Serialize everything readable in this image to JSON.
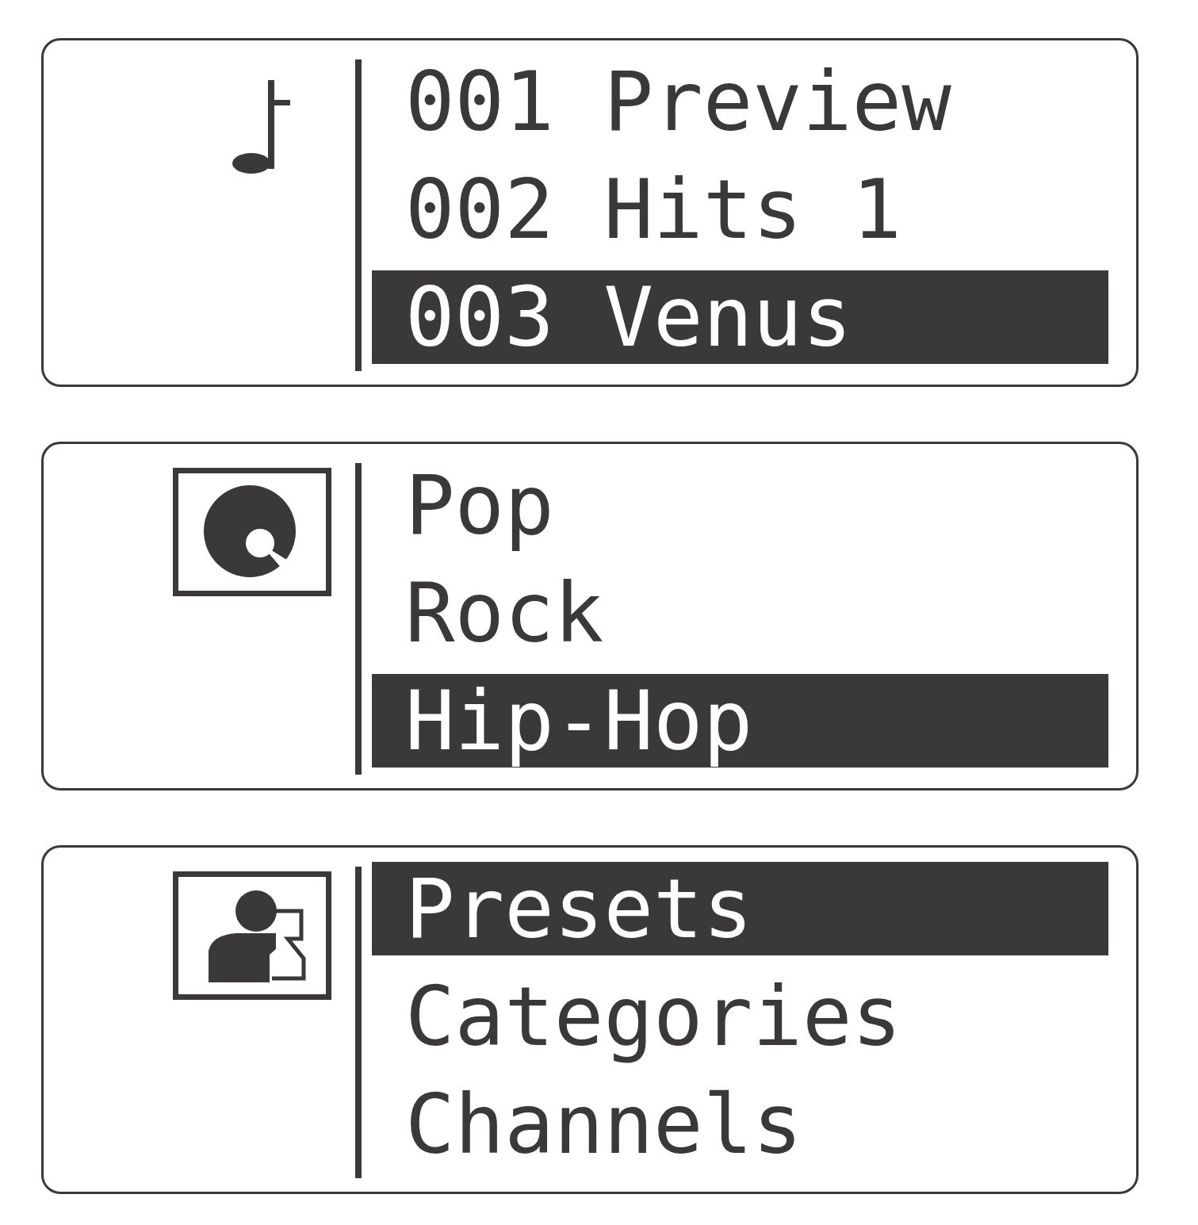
{
  "panels": [
    {
      "kind": "note",
      "items": [
        {
          "label": "001 Preview",
          "selected": false
        },
        {
          "label": "002 Hits 1",
          "selected": false
        },
        {
          "label": "003 Venus",
          "selected": true
        }
      ]
    },
    {
      "kind": "disc",
      "items": [
        {
          "label": "Pop",
          "selected": false
        },
        {
          "label": "Rock",
          "selected": false
        },
        {
          "label": "Hip-Hop",
          "selected": true
        }
      ]
    },
    {
      "kind": "person",
      "items": [
        {
          "label": "Presets",
          "selected": true
        },
        {
          "label": "Categories",
          "selected": false
        },
        {
          "label": "Channels",
          "selected": false
        }
      ]
    }
  ]
}
